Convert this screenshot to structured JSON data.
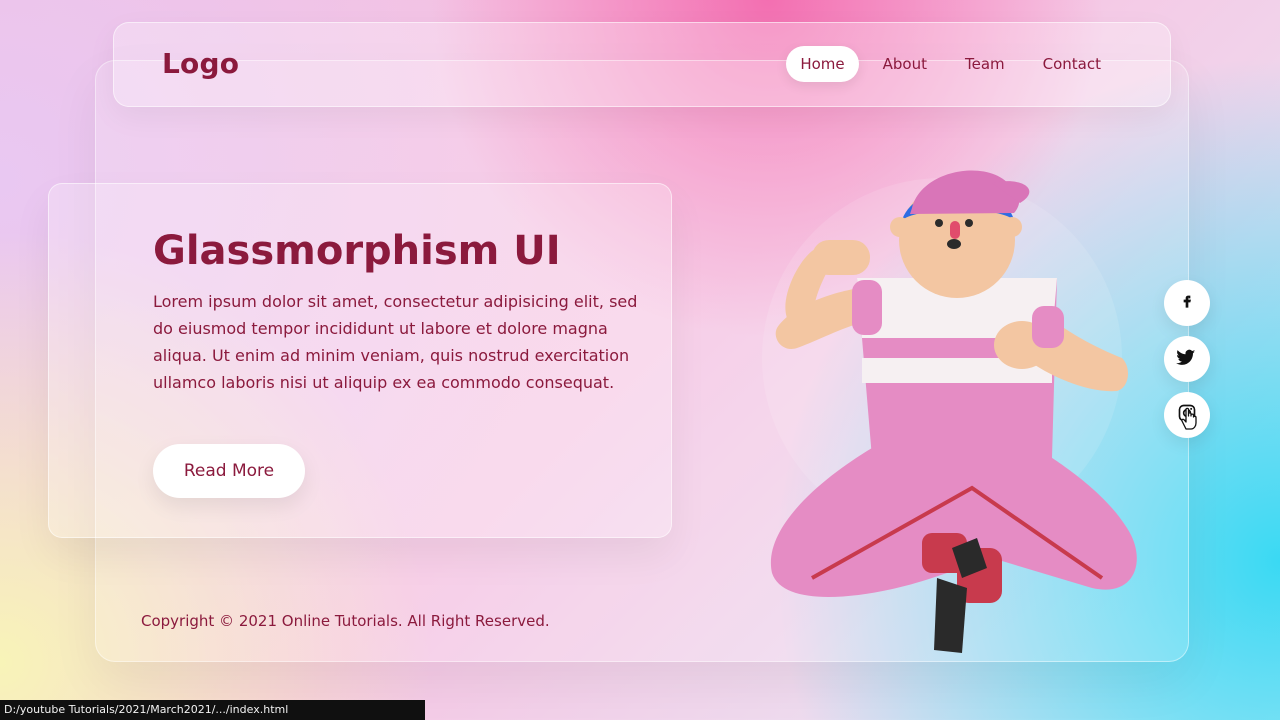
{
  "navbar": {
    "logo": "Logo",
    "items": [
      {
        "label": "Home",
        "active": true
      },
      {
        "label": "About",
        "active": false
      },
      {
        "label": "Team",
        "active": false
      },
      {
        "label": "Contact",
        "active": false
      }
    ]
  },
  "hero": {
    "title": "Glassmorphism UI",
    "paragraph": "Lorem ipsum dolor sit amet, consectetur adipisicing elit, sed do eiusmod tempor incididunt ut labore et dolore magna aliqua. Ut enim ad minim veniam, quis nostrud exercitation ullamco laboris nisi ut aliquip ex ea commodo consequat.",
    "button_label": "Read More"
  },
  "footer": {
    "copyright": "Copyright © 2021 Online Tutorials. All Right Reserved."
  },
  "social": [
    {
      "icon": "facebook-icon"
    },
    {
      "icon": "bird-icon"
    },
    {
      "icon": "instagram-icon"
    }
  ],
  "status_bar": {
    "url": "D:/youtube Tutorials/2021/March2021/.../index.html"
  },
  "colors": {
    "accent": "#8b1a3d",
    "pink": "#f36fb1",
    "cyan": "#3ad9f3"
  }
}
